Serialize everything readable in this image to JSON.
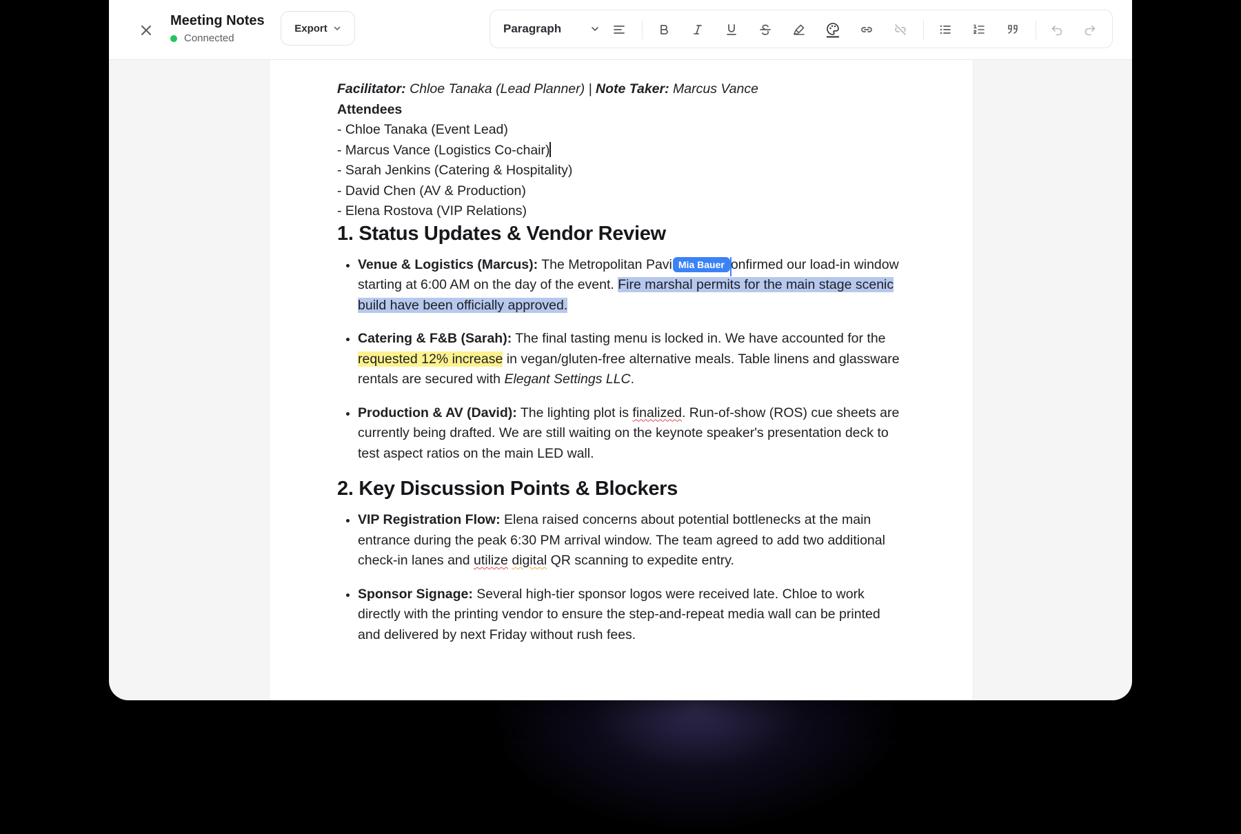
{
  "header": {
    "title": "Meeting Notes",
    "status": "Connected",
    "export_label": "Export",
    "close_icon": "close-icon"
  },
  "toolbar": {
    "block_type": "Paragraph",
    "buttons": [
      "align-left-icon",
      "bold-icon",
      "italic-icon",
      "underline-icon",
      "strikethrough-icon",
      "highlighter-icon",
      "palette-icon",
      "link-icon",
      "unlink-icon",
      "bullet-list-icon",
      "ordered-list-icon",
      "quote-icon",
      "undo-icon",
      "redo-icon"
    ]
  },
  "collaborator": {
    "name": "Mia Bauer",
    "color": "#3b82f6"
  },
  "colors": {
    "selection": "#b6c8ee",
    "highlight": "#fdf28f",
    "status": "#22c55e"
  },
  "doc": {
    "facilitator_label": "Facilitator:",
    "facilitator": " Chloe Tanaka (Lead Planner) | ",
    "note_taker_label": "Note Taker:",
    "note_taker": " Marcus Vance",
    "attendees_heading": "Attendees",
    "attendees": [
      "- Chloe Tanaka (Event Lead)",
      "- Marcus Vance (Logistics Co-chair)",
      "- Sarah Jenkins (Catering & Hospitality)",
      "- David Chen (AV & Production)",
      "- Elena Rostova (VIP Relations)"
    ],
    "section1": {
      "heading": "1. Status Updates & Vendor Review",
      "venue": {
        "label": "Venue & Logistics (Marcus):",
        "t1": " The Metropolitan Pavi",
        "t2": "onfirmed our load-in window starting at 6:00 AM on the day of the event. ",
        "selected": "Fire marshal permits for the main stage scenic build have been officially approved."
      },
      "catering": {
        "label": "Catering & F&B (Sarah):",
        "t1": " The final tasting menu is locked in. We have accounted for the ",
        "highlight": "requested 12% increase",
        "t2": " in vegan/gluten-free alternative meals. Table linens and glassware rentals are secured with ",
        "vendor": "Elegant Settings LLC",
        "t3": "."
      },
      "production": {
        "label": "Production & AV (David):",
        "t1": " The lighting plot is ",
        "misspelled": "finalized",
        "t2": ". Run-of-show (ROS) cue sheets are currently being drafted. We are still waiting on the keynote speaker's presentation deck to test aspect ratios on the main LED wall."
      }
    },
    "section2": {
      "heading": "2. Key Discussion Points & Blockers",
      "vip": {
        "label": "VIP Registration Flow:",
        "t1": " Elena raised concerns about potential bottlenecks at the main entrance during the peak 6:30 PM arrival window. The team agreed to add two additional check-in lanes and ",
        "misspelled": "utilize",
        "space": " ",
        "grammar": "digital",
        "t2": " QR scanning to expedite entry."
      },
      "signage": {
        "label": "Sponsor Signage:",
        "t1": " Several high-tier sponsor logos were received late. Chloe to work directly with the printing vendor to ensure the step-and-repeat media wall can be printed and delivered by next Friday without rush fees."
      }
    }
  }
}
